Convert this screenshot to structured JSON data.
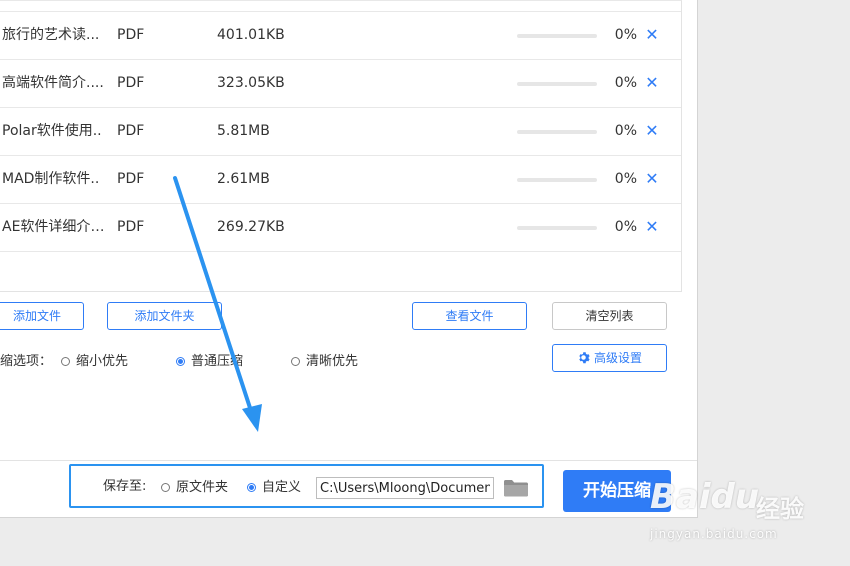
{
  "files": [
    {
      "name": "旅行的艺术读...",
      "type": "PDF",
      "size": "401.01KB",
      "progress": 0,
      "percent": "0%",
      "remove": "✕"
    },
    {
      "name": "高端软件简介....",
      "type": "PDF",
      "size": "323.05KB",
      "progress": 0,
      "percent": "0%",
      "remove": "✕"
    },
    {
      "name": "Polar软件使用..",
      "type": "PDF",
      "size": "5.81MB",
      "progress": 0,
      "percent": "0%",
      "remove": "✕"
    },
    {
      "name": "MAD制作软件..",
      "type": "PDF",
      "size": "2.61MB",
      "progress": 0,
      "percent": "0%",
      "remove": "✕"
    },
    {
      "name": "AE软件详细介....",
      "type": "PDF",
      "size": "269.27KB",
      "progress": 0,
      "percent": "0%",
      "remove": "✕"
    }
  ],
  "toolbar": {
    "add_file": "添加文件",
    "add_folder": "添加文件夹",
    "view_files": "查看文件",
    "clear_list": "清空列表",
    "advanced": "高级设置"
  },
  "options": {
    "label": "缩选项：",
    "items": [
      {
        "label": "缩小优先",
        "checked": false
      },
      {
        "label": "普通压缩",
        "checked": true
      },
      {
        "label": "清晰优先",
        "checked": false
      }
    ]
  },
  "save": {
    "label": "保存至:",
    "original_folder": "原文件夹",
    "custom": "自定义",
    "selected": "custom",
    "path": "C:\\Users\\Mloong\\Documents"
  },
  "start_button": "开始压缩",
  "watermark": {
    "logo": "Baidu",
    "title": "经验",
    "url": "jingyan.baidu.com"
  },
  "colors": {
    "accent": "#2f7cf6",
    "annotation": "#2b93f0"
  },
  "icons": {
    "remove": "close-icon",
    "advanced": "gear-icon",
    "folder": "folder-icon"
  }
}
